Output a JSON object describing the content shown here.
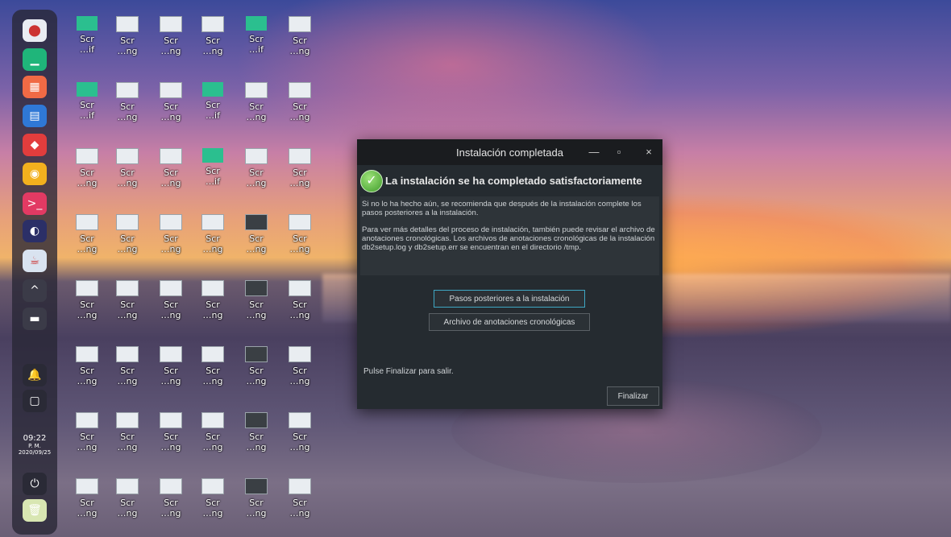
{
  "dock": {
    "items": [
      {
        "name": "launcher-icon",
        "glyph": "⬤",
        "bg": "#e9ecf3"
      },
      {
        "name": "terminal-app-icon",
        "glyph": "▁",
        "bg": "#1fb57a"
      },
      {
        "name": "app-store-icon",
        "glyph": "▦",
        "bg": "#f06a45"
      },
      {
        "name": "file-manager-icon",
        "glyph": "▤",
        "bg": "#2f78d6"
      },
      {
        "name": "3d-cube-icon",
        "glyph": "◆",
        "bg": "#e23d3d"
      },
      {
        "name": "chrome-icon",
        "glyph": "◉",
        "bg": "#f2b01e"
      },
      {
        "name": "terminal-icon",
        "glyph": ">_",
        "bg": "#e23a63"
      },
      {
        "name": "eclipse-icon",
        "glyph": "◐",
        "bg": "#2b2f67"
      },
      {
        "name": "java-icon",
        "glyph": "☕",
        "bg": "#d9e3f0"
      },
      {
        "name": "chevron-up-icon",
        "glyph": "^",
        "bg": "#3b3b48"
      },
      {
        "name": "minimize-dock-icon",
        "glyph": "▬",
        "bg": "#3b3b48"
      },
      {
        "name": "bell-icon",
        "glyph": "🔔",
        "bg": "#2a2a36"
      },
      {
        "name": "window-switcher-icon",
        "glyph": "▢",
        "bg": "#2a2a36"
      }
    ],
    "clock": {
      "time": "09:22",
      "ampm": "P. M.",
      "date": "2020/09/25"
    },
    "power": {
      "name": "power-icon",
      "glyph": "⏻"
    },
    "trash": {
      "name": "trash-icon",
      "glyph": "🗑"
    }
  },
  "desktop": {
    "rows": [
      [
        "Scr …if",
        "Scr …ng",
        "Scr …ng",
        "Scr …ng",
        "Scr …if",
        "Scr …ng"
      ],
      [
        "Scr …if",
        "Scr …ng",
        "Scr …ng",
        "Scr …if",
        "Scr …ng",
        "Scr …ng"
      ],
      [
        "Scr …ng",
        "Scr …ng",
        "Scr …ng",
        "Scr …if",
        "Scr …ng",
        "Scr …ng"
      ],
      [
        "Scr …ng",
        "Scr …ng",
        "Scr …ng",
        "Scr …ng",
        "Scr …ng",
        "Scr …ng"
      ],
      [
        "Scr …ng",
        "Scr …ng",
        "Scr …ng",
        "Scr …ng",
        "Scr …ng",
        "Scr …ng"
      ],
      [
        "Scr …ng",
        "Scr …ng",
        "Scr …ng",
        "Scr …ng",
        "Scr …ng",
        "Scr …ng"
      ],
      [
        "Scr …ng",
        "Scr …ng",
        "Scr …ng",
        "Scr …ng",
        "Scr …ng",
        "Scr …ng"
      ],
      [
        "Scr …ng",
        "Scr …ng",
        "Scr …ng",
        "Scr …ng",
        "Scr …ng",
        "Scr …ng"
      ]
    ]
  },
  "dialog": {
    "title": "Instalación completada",
    "minimize": "—",
    "maximize": "▫",
    "close": "×",
    "header": "La instalación se ha completado satisfactoriamente",
    "info_p1": "Si no lo ha hecho aún, se recomienda que después de la instalación complete los pasos posteriores a la instalación.",
    "info_p2": "Para ver más detalles del proceso de instalación, también puede revisar el archivo de anotaciones cronológicas. Los archivos de anotaciones cronológicas de la instalación db2setup.log y db2setup.err se encuentran en el directorio /tmp.",
    "post_steps_button": "Pasos posteriores a la instalación",
    "log_button": "Archivo de anotaciones cronológicas",
    "exit_text": "Pulse Finalizar para salir.",
    "finish_button": "Finalizar"
  }
}
